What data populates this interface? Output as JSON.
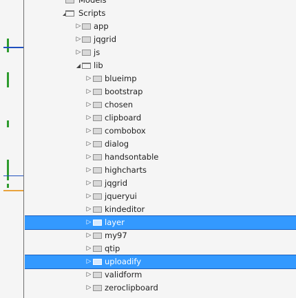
{
  "tree": {
    "items": [
      {
        "label": "Models",
        "depth": 0,
        "state": "leaf",
        "open": false
      },
      {
        "label": "Scripts",
        "depth": 0,
        "state": "expanded",
        "open": true
      },
      {
        "label": "app",
        "depth": 1,
        "state": "collapsed",
        "open": false
      },
      {
        "label": "jqgrid",
        "depth": 1,
        "state": "collapsed",
        "open": false
      },
      {
        "label": "js",
        "depth": 1,
        "state": "collapsed",
        "open": false
      },
      {
        "label": "lib",
        "depth": 1,
        "state": "expanded",
        "open": true
      },
      {
        "label": "blueimp",
        "depth": 2,
        "state": "collapsed",
        "open": false
      },
      {
        "label": "bootstrap",
        "depth": 2,
        "state": "collapsed",
        "open": false
      },
      {
        "label": "chosen",
        "depth": 2,
        "state": "collapsed",
        "open": false
      },
      {
        "label": "clipboard",
        "depth": 2,
        "state": "collapsed",
        "open": false
      },
      {
        "label": "combobox",
        "depth": 2,
        "state": "collapsed",
        "open": false
      },
      {
        "label": "dialog",
        "depth": 2,
        "state": "collapsed",
        "open": false
      },
      {
        "label": "handsontable",
        "depth": 2,
        "state": "collapsed",
        "open": false
      },
      {
        "label": "highcharts",
        "depth": 2,
        "state": "collapsed",
        "open": false
      },
      {
        "label": "jqgrid",
        "depth": 2,
        "state": "collapsed",
        "open": false
      },
      {
        "label": "jqueryui",
        "depth": 2,
        "state": "collapsed",
        "open": false
      },
      {
        "label": "kindeditor",
        "depth": 2,
        "state": "collapsed",
        "open": false
      },
      {
        "label": "layer",
        "depth": 2,
        "state": "collapsed",
        "open": false,
        "selected": true
      },
      {
        "label": "my97",
        "depth": 2,
        "state": "collapsed",
        "open": false
      },
      {
        "label": "qtip",
        "depth": 2,
        "state": "collapsed",
        "open": false
      },
      {
        "label": "uploadify",
        "depth": 2,
        "state": "collapsed",
        "open": false,
        "selected": true
      },
      {
        "label": "validform",
        "depth": 2,
        "state": "collapsed",
        "open": false
      },
      {
        "label": "zeroclipboard",
        "depth": 2,
        "state": "collapsed",
        "open": false
      }
    ]
  },
  "colors": {
    "selection": "#3399ff",
    "gutter_marker_green": "#2e9b2e",
    "gutter_marker_blue": "#1f4fbf",
    "gutter_marker_orange": "#e8a33d"
  }
}
